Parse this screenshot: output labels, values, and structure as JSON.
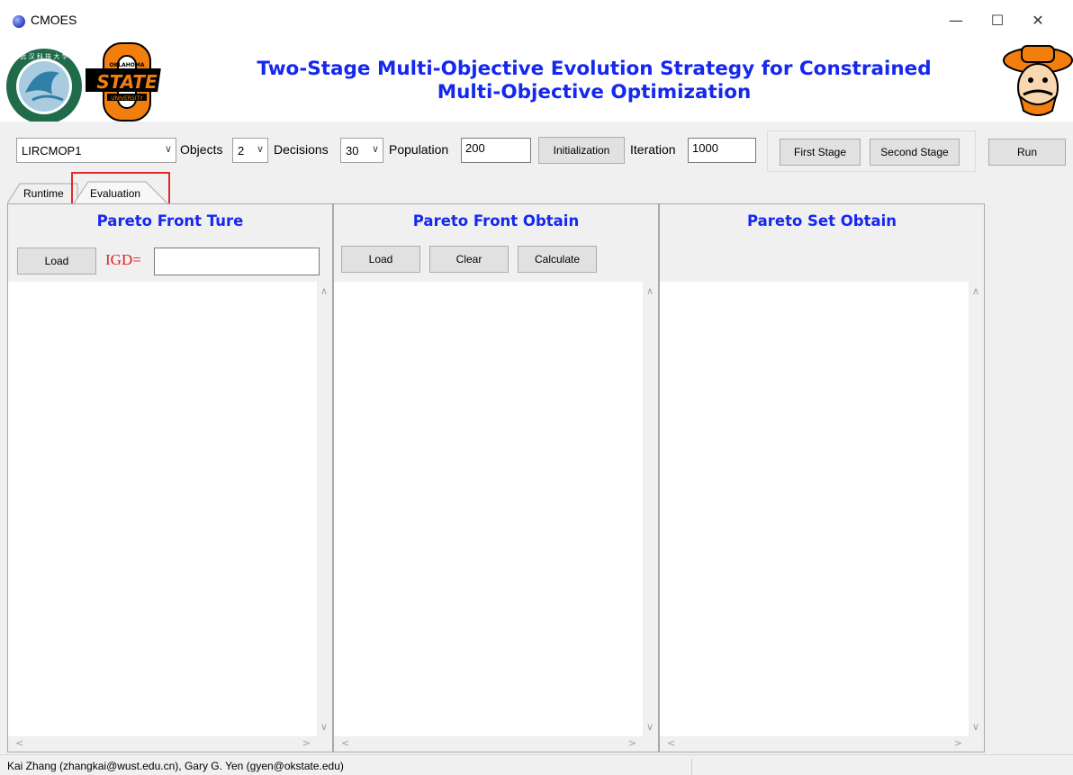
{
  "window": {
    "title": "CMOES",
    "minimize": "—",
    "maximize": "☐",
    "close": "✕"
  },
  "header": {
    "title_line1": "Two-Stage Multi-Objective Evolution Strategy for Constrained",
    "title_line2": "Multi-Objective Optimization",
    "logos": [
      "wust-logo",
      "oklahoma-state-logo",
      "pistol-pete-mascot-logo"
    ]
  },
  "toolbar": {
    "problem": "LIRCMOP1",
    "objects_label": "Objects",
    "objects_value": "2",
    "decisions_label": "Decisions",
    "decisions_value": "30",
    "population_label": "Population",
    "population_value": "200",
    "initialization_button": "Initialization",
    "iteration_label": "Iteration",
    "iteration_value": "1000",
    "first_stage_button": "First Stage",
    "second_stage_button": "Second Stage",
    "run_button": "Run"
  },
  "tabs": [
    {
      "label": "Runtime"
    },
    {
      "label": "Evaluation",
      "active": true
    }
  ],
  "panels": {
    "front_true": {
      "title": "Pareto Front Ture",
      "load_button": "Load",
      "igd_label": "IGD=",
      "igd_value": ""
    },
    "front_obtain": {
      "title": "Pareto Front Obtain",
      "load_button": "Load",
      "clear_button": "Clear",
      "calculate_button": "Calculate"
    },
    "set_obtain": {
      "title": "Pareto Set Obtain"
    }
  },
  "status": {
    "text": "Kai Zhang (zhangkai@wust.edu.cn),  Gary G. Yen (gyen@okstate.edu)"
  },
  "colors": {
    "title_blue": "#1528EE",
    "igd_red": "#E02020",
    "highlight_red": "#E12B2B"
  }
}
